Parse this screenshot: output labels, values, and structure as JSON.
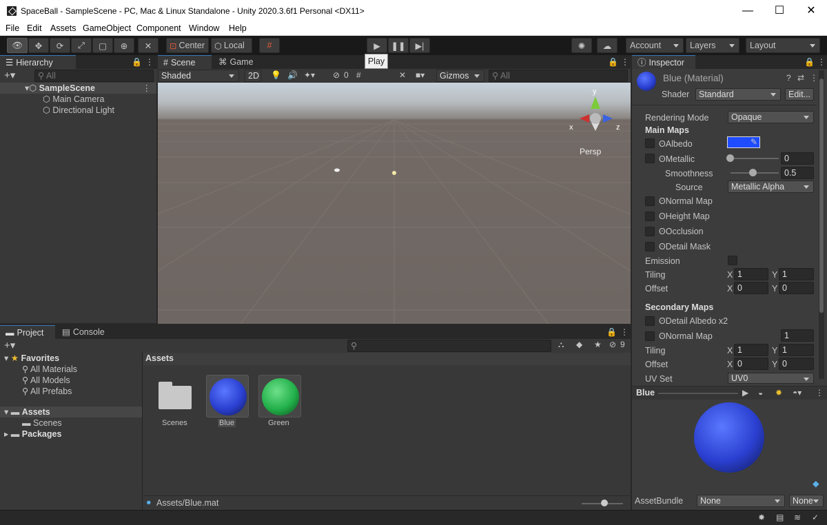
{
  "window": {
    "title": "SpaceBall - SampleScene - PC, Mac & Linux Standalone - Unity 2020.3.6f1 Personal <DX11>",
    "minimize": "—",
    "maximize": "☐",
    "close": "✕"
  },
  "menu": [
    "File",
    "Edit",
    "Assets",
    "GameObject",
    "Component",
    "Window",
    "Help"
  ],
  "toolbar": {
    "center": "Center",
    "local": "Local",
    "account": "Account",
    "layers": "Layers",
    "layout": "Layout",
    "tooltip": "Play"
  },
  "hierarchy": {
    "tab": "Hierarchy",
    "search_placeholder": "All",
    "scene": "SampleScene",
    "items": [
      "Main Camera",
      "Directional Light"
    ]
  },
  "scene": {
    "tab_scene": "Scene",
    "tab_game": "Game",
    "shading": "Shaded",
    "mode2d": "2D",
    "hidden_count": "0",
    "gizmos": "Gizmos",
    "search_placeholder": "All",
    "persp": "Persp",
    "axis_x": "x",
    "axis_y": "y",
    "axis_z": "z"
  },
  "project": {
    "tab_project": "Project",
    "tab_console": "Console",
    "hidden_count": "9",
    "favorites": "Favorites",
    "fav_items": [
      "All Materials",
      "All Models",
      "All Prefabs"
    ],
    "assets": "Assets",
    "assets_children": [
      "Scenes"
    ],
    "packages": "Packages",
    "breadcrumb": "Assets",
    "grid_items": [
      "Scenes",
      "Blue",
      "Green"
    ],
    "footer_path": "Assets/Blue.mat"
  },
  "inspector": {
    "tab": "Inspector",
    "material_name": "Blue (Material)",
    "shader_label": "Shader",
    "shader_value": "Standard",
    "edit_btn": "Edit...",
    "rendering_mode_label": "Rendering Mode",
    "rendering_mode_value": "Opaque",
    "main_maps": "Main Maps",
    "albedo": "Albedo",
    "metallic": "Metallic",
    "metallic_value": "0",
    "smoothness": "Smoothness",
    "smoothness_value": "0.5",
    "source": "Source",
    "source_value": "Metallic Alpha",
    "normal_map": "Normal Map",
    "height_map": "Height Map",
    "occlusion": "Occlusion",
    "detail_mask": "Detail Mask",
    "emission": "Emission",
    "tiling": "Tiling",
    "offset": "Offset",
    "x": "X",
    "y": "Y",
    "tiling_x": "1",
    "tiling_y": "1",
    "offset_x": "0",
    "offset_y": "0",
    "secondary_maps": "Secondary Maps",
    "detail_albedo": "Detail Albedo x2",
    "normal_map2": "Normal Map",
    "normal_map2_value": "1",
    "tiling2_x": "1",
    "tiling2_y": "1",
    "offset2_x": "0",
    "offset2_y": "0",
    "uv_set": "UV Set",
    "uv_set_value": "UV0",
    "preview_name": "Blue",
    "assetbundle_label": "AssetBundle",
    "assetbundle_value": "None",
    "assetbundle_variant": "None"
  },
  "colors": {
    "albedo": "#1f4cff",
    "blue_sphere": "#2a3fd0",
    "green_sphere": "#22b04a"
  }
}
